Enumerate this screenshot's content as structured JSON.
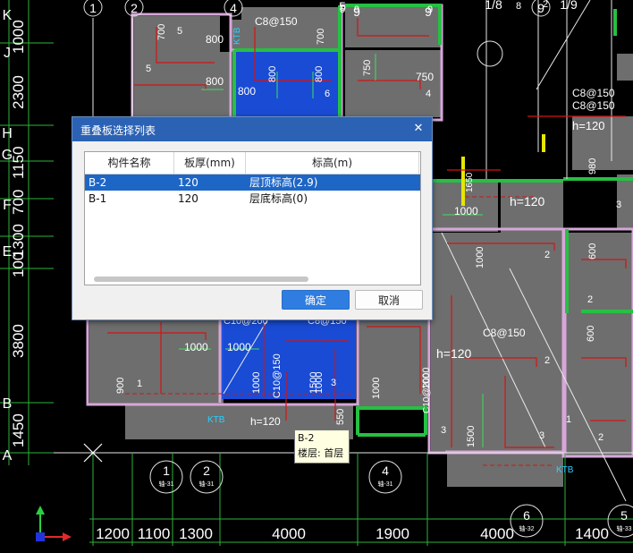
{
  "dialog": {
    "title": "重叠板选择列表",
    "close_icon": "close-icon",
    "columns": [
      "构件名称",
      "板厚(mm)",
      "标高(m)"
    ],
    "rows": [
      {
        "name": "B-2",
        "thickness": "120",
        "elevation": "层顶标高(2.9)",
        "selected": true
      },
      {
        "name": "B-1",
        "thickness": "120",
        "elevation": "层底标高(0)",
        "selected": false
      }
    ],
    "ok_label": "确定",
    "cancel_label": "取消"
  },
  "tooltip": {
    "line1": "B-2",
    "line2": "楼层: 首层"
  },
  "cad": {
    "top_axes": [
      "1",
      "2",
      "4",
      "5",
      "9",
      "9",
      "1/8",
      "9",
      "1/9"
    ],
    "left_dims": [
      "1000",
      "2300",
      "1150",
      "700",
      "1300",
      "100",
      "3800",
      "1450"
    ],
    "left_axes": [
      "K",
      "J",
      "H",
      "G",
      "F",
      "E",
      "B",
      "A"
    ],
    "bottom_dims": [
      "1200",
      "1100",
      "1300",
      "4000",
      "1900",
      "4000",
      "1400"
    ],
    "bottom_axes": [
      "1",
      "2",
      "4",
      "6",
      "5"
    ],
    "bottom_axis_tags": [
      "轴-31",
      "轴-31",
      "轴-31",
      "轴-32",
      "轴-33"
    ],
    "labels": [
      "C8@150",
      "C8@150",
      "C8@150",
      "C8@150",
      "C10@200",
      "C10@150",
      "C10@200",
      "C8@150",
      "h=120",
      "h=120",
      "h=120",
      "h=120",
      "KTB",
      "KTB",
      "KTB",
      "700",
      "800",
      "800",
      "800",
      "800",
      "800",
      "750",
      "750",
      "900",
      "1000",
      "1000",
      "1000",
      "1000",
      "1000",
      "1000",
      "1000",
      "1000",
      "1500",
      "1500",
      "1000",
      "550",
      "980",
      "600",
      "600",
      "700",
      "1650",
      "2C14"
    ],
    "slab_nums": [
      "5",
      "5",
      "4",
      "4",
      "6",
      "3",
      "3",
      "1",
      "2",
      "2",
      "2",
      "2",
      "3",
      "3",
      "1",
      "8",
      "9",
      "9",
      "2",
      "5"
    ]
  }
}
